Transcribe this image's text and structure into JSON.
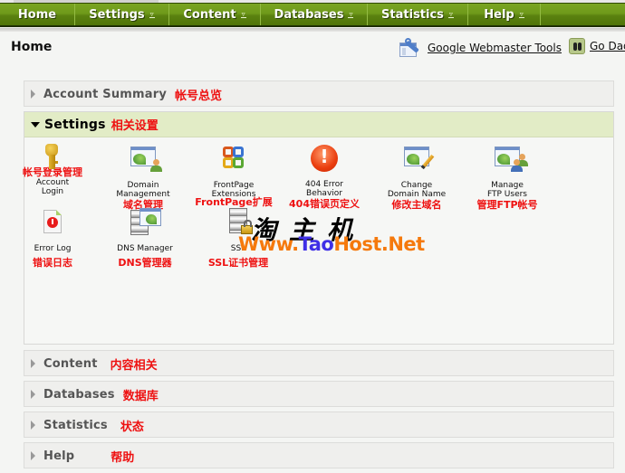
{
  "nav": {
    "items": [
      {
        "label": "Home",
        "has_dropdown": false
      },
      {
        "label": "Settings",
        "has_dropdown": true
      },
      {
        "label": "Content",
        "has_dropdown": true
      },
      {
        "label": "Databases",
        "has_dropdown": true
      },
      {
        "label": "Statistics",
        "has_dropdown": true
      },
      {
        "label": "Help",
        "has_dropdown": true
      }
    ],
    "dropdown_glyph": "▿",
    "colors": {
      "bar": "#6f9a1a",
      "text": "#ffffff"
    }
  },
  "header": {
    "title": "Home",
    "links": [
      {
        "label": "Google Webmaster Tools",
        "icon": "webmaster-tools-icon"
      },
      {
        "label": "Go Dad",
        "icon": "godaddy-icon"
      }
    ]
  },
  "sections": [
    {
      "title": "Account Summary",
      "cn": "帐号总览",
      "expanded": false
    },
    {
      "title": "Settings",
      "cn": "相关设置",
      "expanded": true
    },
    {
      "title": "Content",
      "cn": "内容相关",
      "expanded": false
    },
    {
      "title": "Databases",
      "cn": "数据库",
      "expanded": false
    },
    {
      "title": "Statistics",
      "cn": "状态",
      "expanded": false
    },
    {
      "title": "Help",
      "cn": "帮助",
      "expanded": false
    }
  ],
  "settings_tools": [
    {
      "label_1": "Account",
      "label_2": "Login",
      "cn": "帐号登录管理",
      "icon": "key-icon"
    },
    {
      "label_1": "Domain",
      "label_2": "Management",
      "cn": "域名管理",
      "icon": "domain-management-icon"
    },
    {
      "label_1": "FrontPage",
      "label_2": "Extensions",
      "cn": "FrontPage扩展",
      "icon": "frontpage-icon"
    },
    {
      "label_1": "404 Error",
      "label_2": "Behavior",
      "cn": "404错误页定义",
      "icon": "error-404-icon"
    },
    {
      "label_1": "Change",
      "label_2": "Domain Name",
      "cn": "修改主域名",
      "icon": "change-domain-icon"
    },
    {
      "label_1": "Manage",
      "label_2": "FTP Users",
      "cn": "管理FTP帐号",
      "icon": "ftp-users-icon"
    },
    {
      "label_1": "Error Log",
      "label_2": "",
      "cn": "错误日志",
      "icon": "error-log-icon"
    },
    {
      "label_1": "DNS Manager",
      "label_2": "",
      "cn": "DNS管理器",
      "icon": "dns-manager-icon"
    },
    {
      "label_1": "SSL",
      "label_2": "",
      "cn": "SSL证书管理",
      "icon": "ssl-icon"
    }
  ],
  "watermark": {
    "cn": "淘主机",
    "url_prefix": "Www.",
    "url_mid": "Tao",
    "url_suffix": "Host.Net"
  },
  "accent_colors": {
    "annotation_red": "#ee1111",
    "settings_header_bg": "#e2ecc6"
  }
}
